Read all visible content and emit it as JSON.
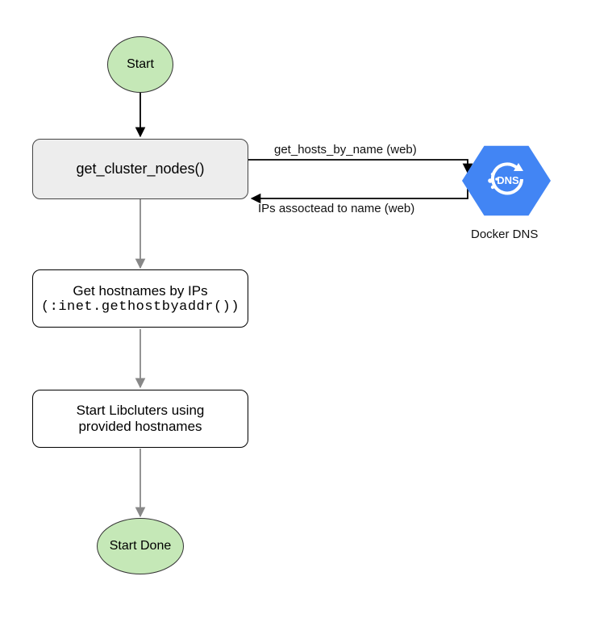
{
  "nodes": {
    "start": {
      "label": "Start"
    },
    "get_cluster_nodes": {
      "label": "get_cluster_nodes()"
    },
    "get_hostnames": {
      "label_line1": "Get hostnames by IPs",
      "label_line2": "(:inet.gethostbyaddr())"
    },
    "start_libclusters": {
      "label_line1": "Start Libcluters using",
      "label_line2": "provided hostnames"
    },
    "start_done": {
      "label": "Start Done"
    },
    "docker_dns": {
      "label": "Docker DNS",
      "icon_text": "DNS"
    }
  },
  "edges": {
    "to_dns": {
      "label": "get_hosts_by_name (web)"
    },
    "from_dns": {
      "label": "IPs assoctead to name (web)"
    }
  }
}
